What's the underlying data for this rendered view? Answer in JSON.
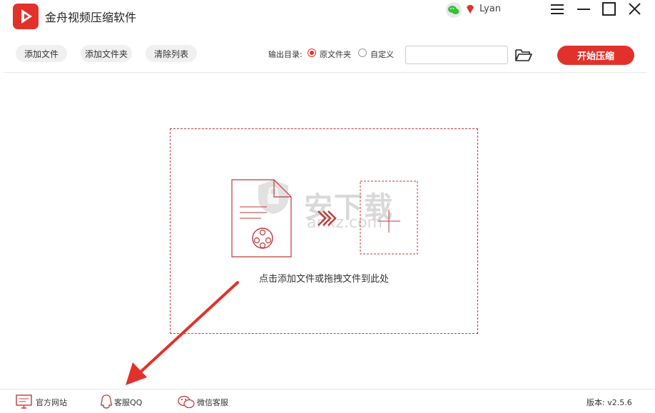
{
  "app": {
    "title": "金舟视频压缩软件",
    "username": "Lyan"
  },
  "toolbar": {
    "add_file": "添加文件",
    "add_folder": "添加文件夹",
    "clear_list": "清除列表",
    "output_label": "输出目录:",
    "option_source": "原文件夹",
    "option_custom": "自定义",
    "selected_option": "原文件夹",
    "output_path": "",
    "start": "开始压缩"
  },
  "dropzone": {
    "hint": "点击添加文件或拖拽文件到此处"
  },
  "watermark": {
    "text": "安下载",
    "sub": "anxz.com"
  },
  "footer": {
    "website": "官方网站",
    "qq": "客服QQ",
    "wechat": "微信客服",
    "version": "版本:  v2.5.6"
  },
  "colors": {
    "accent": "#e2312b",
    "dashed_border": "#c0393b"
  },
  "icons": [
    "app-logo-icon",
    "wechat-icon",
    "vip-diamond-icon",
    "menu-icon",
    "minimize-icon",
    "maximize-icon",
    "close-icon",
    "folder-open-icon",
    "video-file-icon",
    "arrow-right-icon",
    "monitor-icon",
    "qq-icon",
    "wechat-service-icon"
  ]
}
